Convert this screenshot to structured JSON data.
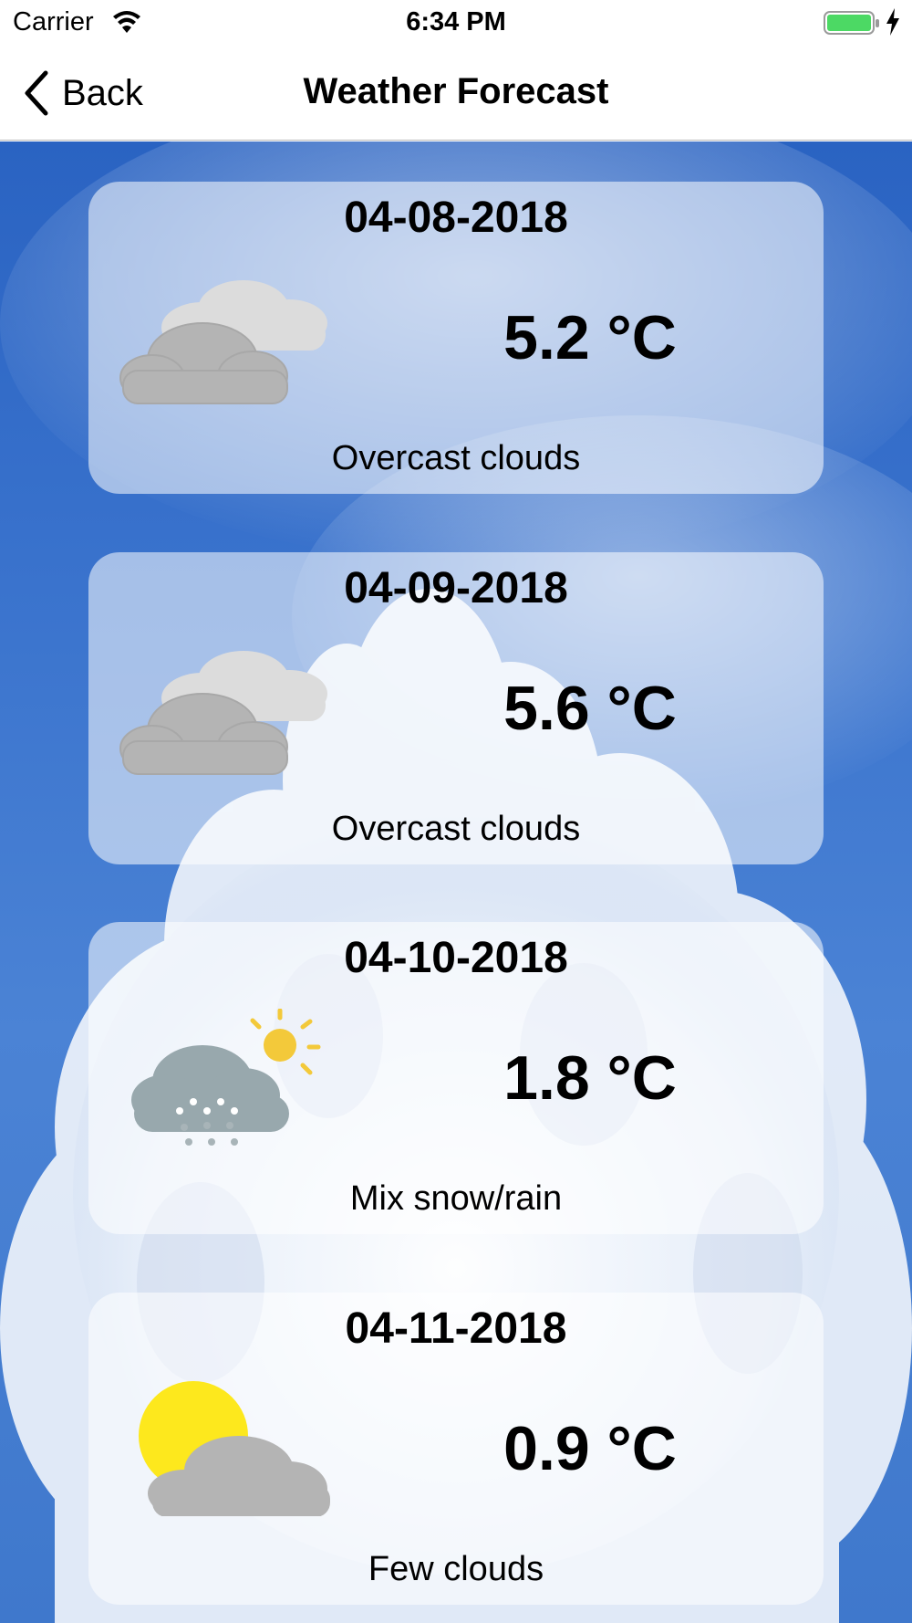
{
  "status_bar": {
    "carrier": "Carrier",
    "time": "6:34 PM",
    "battery_color": "#4cd964"
  },
  "nav": {
    "back_label": "Back",
    "title": "Weather Forecast"
  },
  "forecast": [
    {
      "date": "04-08-2018",
      "temp": "5.2 °C",
      "description": "Overcast clouds",
      "icon": "overcast-clouds-icon"
    },
    {
      "date": "04-09-2018",
      "temp": "5.6 °C",
      "description": "Overcast clouds",
      "icon": "overcast-clouds-icon"
    },
    {
      "date": "04-10-2018",
      "temp": "1.8 °C",
      "description": "Mix snow/rain",
      "icon": "snow-rain-sun-icon"
    },
    {
      "date": "04-11-2018",
      "temp": "0.9 °C",
      "description": "Few clouds",
      "icon": "sun-behind-cloud-icon"
    }
  ]
}
